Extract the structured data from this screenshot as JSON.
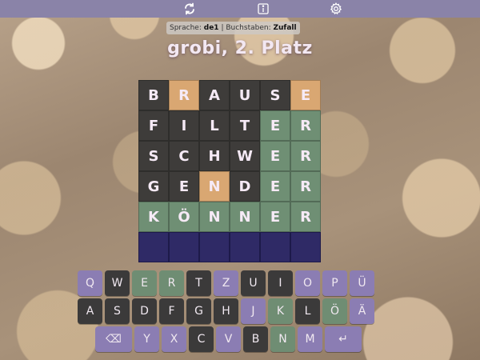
{
  "topbar": {
    "icons": [
      "refresh-icon",
      "info-icon",
      "gear-icon"
    ]
  },
  "info": {
    "language_label": "Sprache:",
    "language_value": "de1",
    "separator": "|",
    "letters_label": "Buchstaben:",
    "letters_value": "Zufall"
  },
  "title": "grobi, 2. Platz",
  "board": [
    [
      {
        "l": "B",
        "s": "absent"
      },
      {
        "l": "R",
        "s": "present"
      },
      {
        "l": "A",
        "s": "absent"
      },
      {
        "l": "U",
        "s": "absent"
      },
      {
        "l": "S",
        "s": "absent"
      },
      {
        "l": "E",
        "s": "present"
      }
    ],
    [
      {
        "l": "F",
        "s": "absent"
      },
      {
        "l": "I",
        "s": "absent"
      },
      {
        "l": "L",
        "s": "absent"
      },
      {
        "l": "T",
        "s": "absent"
      },
      {
        "l": "E",
        "s": "correct"
      },
      {
        "l": "R",
        "s": "correct"
      }
    ],
    [
      {
        "l": "S",
        "s": "absent"
      },
      {
        "l": "C",
        "s": "absent"
      },
      {
        "l": "H",
        "s": "absent"
      },
      {
        "l": "W",
        "s": "absent"
      },
      {
        "l": "E",
        "s": "correct"
      },
      {
        "l": "R",
        "s": "correct"
      }
    ],
    [
      {
        "l": "G",
        "s": "absent"
      },
      {
        "l": "E",
        "s": "absent"
      },
      {
        "l": "N",
        "s": "present"
      },
      {
        "l": "D",
        "s": "absent"
      },
      {
        "l": "E",
        "s": "correct"
      },
      {
        "l": "R",
        "s": "correct"
      }
    ],
    [
      {
        "l": "K",
        "s": "correct"
      },
      {
        "l": "Ö",
        "s": "correct"
      },
      {
        "l": "N",
        "s": "correct"
      },
      {
        "l": "N",
        "s": "correct"
      },
      {
        "l": "E",
        "s": "correct"
      },
      {
        "l": "R",
        "s": "correct"
      }
    ],
    [
      {
        "l": "",
        "s": "empty"
      },
      {
        "l": "",
        "s": "empty"
      },
      {
        "l": "",
        "s": "empty"
      },
      {
        "l": "",
        "s": "empty"
      },
      {
        "l": "",
        "s": "empty"
      },
      {
        "l": "",
        "s": "empty"
      }
    ]
  ],
  "keyboard": {
    "row1": [
      {
        "k": "Q",
        "s": "unused"
      },
      {
        "k": "W",
        "s": "absent"
      },
      {
        "k": "E",
        "s": "correct"
      },
      {
        "k": "R",
        "s": "correct"
      },
      {
        "k": "T",
        "s": "absent"
      },
      {
        "k": "Z",
        "s": "unused"
      },
      {
        "k": "U",
        "s": "absent"
      },
      {
        "k": "I",
        "s": "absent"
      },
      {
        "k": "O",
        "s": "unused"
      },
      {
        "k": "P",
        "s": "unused"
      },
      {
        "k": "Ü",
        "s": "unused"
      }
    ],
    "row2": [
      {
        "k": "A",
        "s": "absent"
      },
      {
        "k": "S",
        "s": "absent"
      },
      {
        "k": "D",
        "s": "absent"
      },
      {
        "k": "F",
        "s": "absent"
      },
      {
        "k": "G",
        "s": "absent"
      },
      {
        "k": "H",
        "s": "absent"
      },
      {
        "k": "J",
        "s": "unused"
      },
      {
        "k": "K",
        "s": "correct"
      },
      {
        "k": "L",
        "s": "absent"
      },
      {
        "k": "Ö",
        "s": "correct"
      },
      {
        "k": "Ä",
        "s": "unused"
      }
    ],
    "row3": [
      {
        "k": "⌫",
        "s": "unused",
        "wide": true,
        "name": "backspace"
      },
      {
        "k": "Y",
        "s": "unused"
      },
      {
        "k": "X",
        "s": "unused"
      },
      {
        "k": "C",
        "s": "absent"
      },
      {
        "k": "V",
        "s": "unused"
      },
      {
        "k": "B",
        "s": "absent"
      },
      {
        "k": "N",
        "s": "correct"
      },
      {
        "k": "M",
        "s": "unused"
      },
      {
        "k": "↵",
        "s": "unused",
        "wide": true,
        "name": "enter"
      }
    ]
  }
}
